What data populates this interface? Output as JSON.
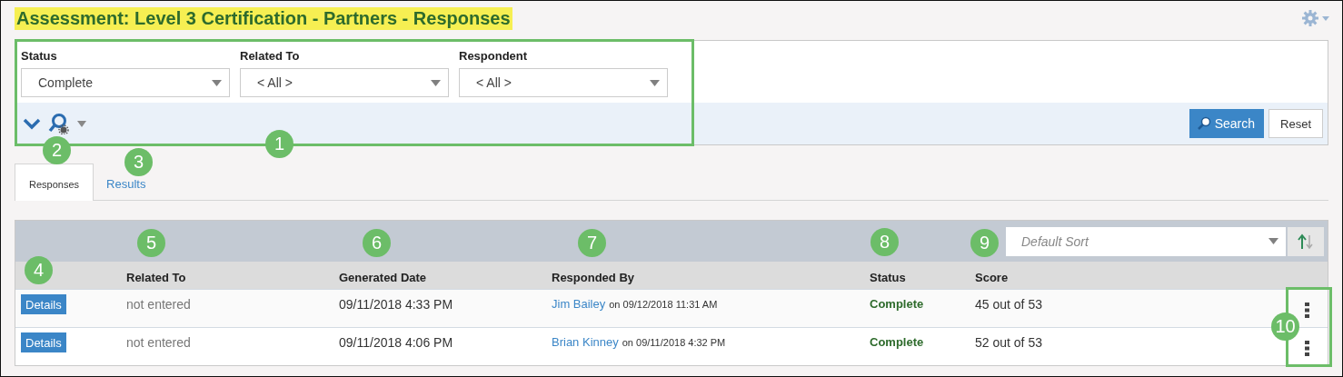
{
  "title": "Assessment: Level 3 Certification - Partners - Responses",
  "filters": [
    {
      "label": "Status",
      "value": "Complete"
    },
    {
      "label": "Related To",
      "value": "< All >"
    },
    {
      "label": "Respondent",
      "value": "< All >"
    }
  ],
  "search_button": "Search",
  "reset_button": "Reset",
  "tabs": [
    {
      "label": "Responses",
      "selected": true
    },
    {
      "label": "Results",
      "selected": false
    }
  ],
  "sort": {
    "placeholder": "Default Sort"
  },
  "table": {
    "columns": [
      "Related To",
      "Generated Date",
      "Responded By",
      "Status",
      "Score"
    ],
    "rows": [
      {
        "action": "Details",
        "related_to": "not entered",
        "generated_date": "09/11/2018 4:33 PM",
        "responded_by": "Jim Bailey",
        "responded_on": "on 09/12/2018 11:31 AM",
        "status": "Complete",
        "score": "45 out of 53"
      },
      {
        "action": "Details",
        "related_to": "not entered",
        "generated_date": "09/11/2018 4:06 PM",
        "responded_by": "Brian Kinney",
        "responded_on": "on 09/11/2018 4:32 PM",
        "status": "Complete",
        "score": "52 out of 53"
      }
    ]
  },
  "callouts": [
    "1",
    "2",
    "3",
    "4",
    "5",
    "6",
    "7",
    "8",
    "9",
    "10"
  ]
}
